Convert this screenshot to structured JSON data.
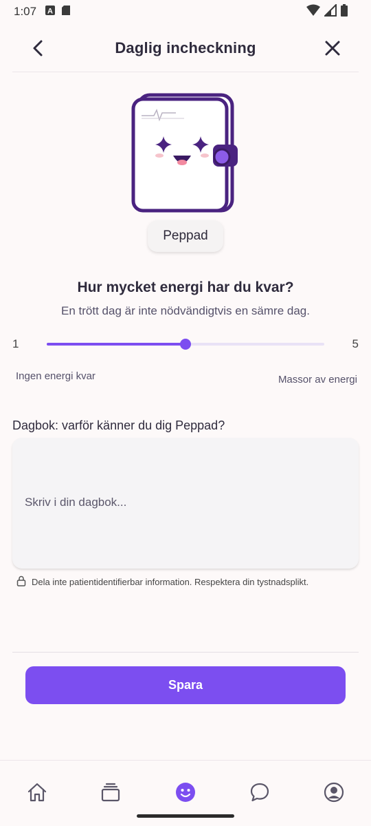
{
  "status_bar": {
    "time": "1:07"
  },
  "header": {
    "title": "Daglig incheckning"
  },
  "mood": {
    "label": "Peppad"
  },
  "question": {
    "title": "Hur mycket energi har du kvar?",
    "subtitle": "En trött dag är inte nödvändigtvis en sämre dag."
  },
  "slider": {
    "min": "1",
    "max": "5",
    "value": 3,
    "min_label": "Ingen energi kvar",
    "max_label": "Massor av energi"
  },
  "diary": {
    "label": "Dagbok: varför känner du dig Peppad?",
    "placeholder": "Skriv i din dagbok...",
    "value": ""
  },
  "privacy_note": "Dela inte patientidentifierbar information. Respektera din tystnadsplikt.",
  "actions": {
    "save_label": "Spara"
  },
  "nav": {
    "items": [
      {
        "icon": "home-icon"
      },
      {
        "icon": "cards-icon"
      },
      {
        "icon": "smiley-icon",
        "active": true
      },
      {
        "icon": "chat-icon"
      },
      {
        "icon": "profile-icon"
      }
    ]
  },
  "colors": {
    "accent": "#7c4ef0",
    "mascot": "#4a2380",
    "background": "#fdf9f9"
  }
}
